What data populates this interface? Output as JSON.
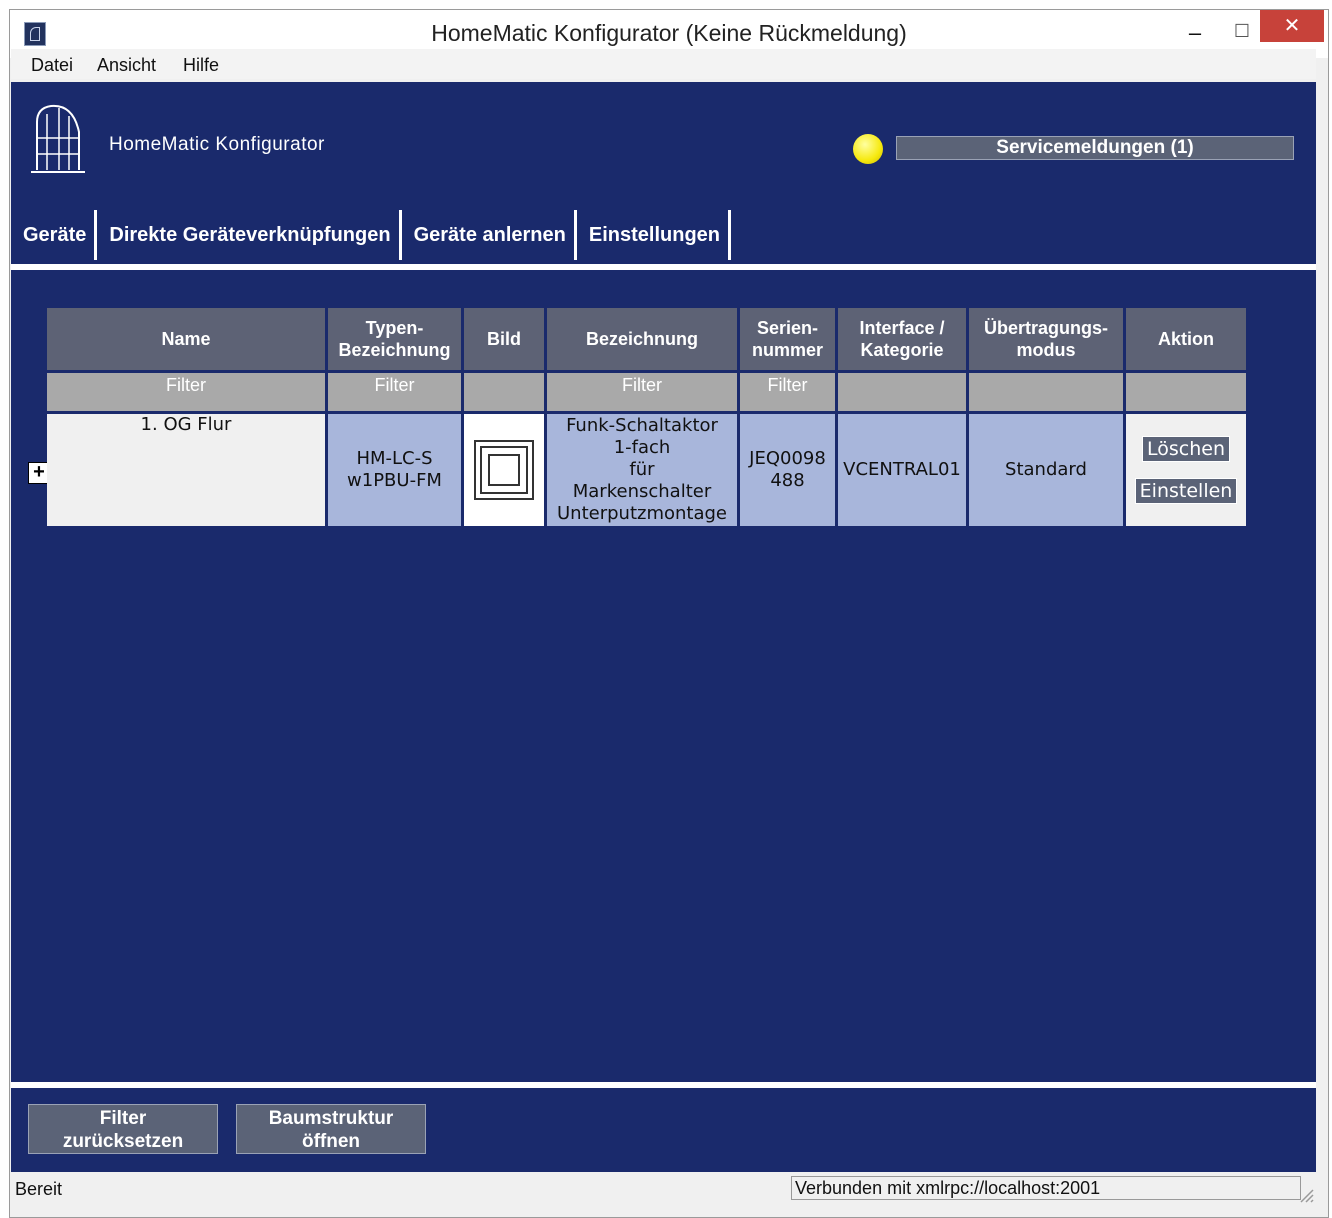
{
  "window": {
    "title": "HomeMatic Konfigurator (Keine Rückmeldung)",
    "controls": {
      "minimize": "‒",
      "maximize": "☐",
      "close": "✕"
    }
  },
  "menu": [
    "Datei",
    "Ansicht",
    "Hilfe"
  ],
  "header": {
    "app_name": "HomeMatic Konfigurator",
    "service_button": "Servicemeldungen (1)",
    "led_color": "#f6e90e"
  },
  "tabs": [
    "Geräte",
    "Direkte Geräteverknüpfungen",
    "Geräte anlernen",
    "Einstellungen"
  ],
  "table": {
    "columns": [
      {
        "line1": "Name",
        "line2": ""
      },
      {
        "line1": "Typen-",
        "line2": "Bezeichnung"
      },
      {
        "line1": "Bild",
        "line2": ""
      },
      {
        "line1": "Bezeichnung",
        "line2": ""
      },
      {
        "line1": "Serien-",
        "line2": "nummer"
      },
      {
        "line1": "Interface /",
        "line2": "Kategorie"
      },
      {
        "line1": "Übertragungs-",
        "line2": "modus"
      },
      {
        "line1": "Aktion",
        "line2": ""
      }
    ],
    "filters": [
      "Filter",
      "Filter",
      "",
      "Filter",
      "Filter",
      "",
      "",
      ""
    ],
    "rows": [
      {
        "expand": "+",
        "name": "1. OG Flur",
        "type_lines": [
          "HM-LC-S",
          "w1PBU-FM"
        ],
        "image_icon": "switch-device-icon",
        "description_lines": [
          "Funk-Schaltaktor",
          "1-fach",
          "für",
          "Markenschalter",
          "Unterputzmontage"
        ],
        "serial_lines": [
          "JEQ0098",
          "488"
        ],
        "interface": "VCENTRAL01",
        "mode": "Standard",
        "actions": [
          "Löschen",
          "Einstellen"
        ]
      }
    ]
  },
  "bottom_buttons": [
    {
      "line1": "Filter",
      "line2": "zurücksetzen"
    },
    {
      "line1": "Baumstruktur",
      "line2": "öffnen"
    }
  ],
  "status": {
    "left": "Bereit",
    "right": "Verbunden mit xmlrpc://localhost:2001"
  }
}
